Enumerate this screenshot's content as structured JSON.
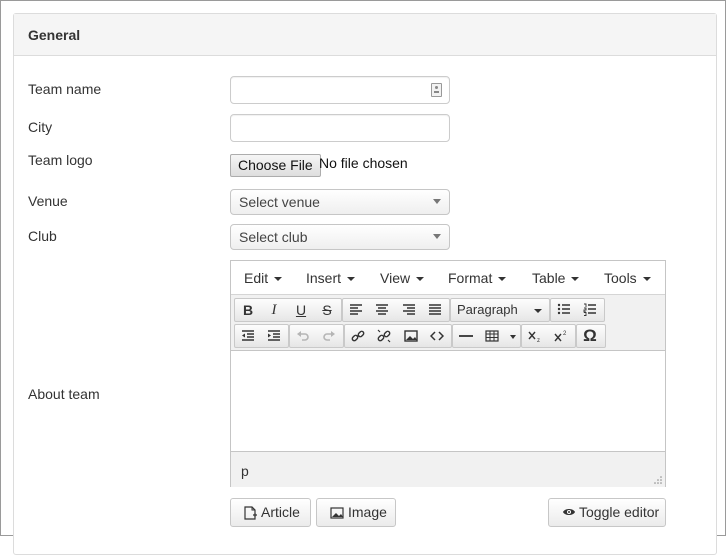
{
  "panel": {
    "title": "General"
  },
  "form": {
    "team_name_label": "Team name",
    "team_name_value": "",
    "city_label": "City",
    "city_value": "",
    "logo_label": "Team logo",
    "logo_button": "Choose File",
    "logo_status": "No file chosen",
    "venue_label": "Venue",
    "venue_value": "Select venue",
    "club_label": "Club",
    "club_value": "Select club",
    "about_label": "About team"
  },
  "editor": {
    "menus": [
      "Edit",
      "Insert",
      "View",
      "Format",
      "Table",
      "Tools"
    ],
    "toolbar": {
      "bold": "B",
      "italic": "I",
      "underline": "U",
      "strike": "S",
      "block_format": "Paragraph",
      "special_char": "Ω",
      "icons": [
        "bold-icon",
        "italic-icon",
        "underline-icon",
        "strikethrough-icon",
        "align-left-icon",
        "align-center-icon",
        "align-right-icon",
        "justify-icon",
        "bullet-list-icon",
        "numbered-list-icon",
        "outdent-icon",
        "indent-icon",
        "undo-icon",
        "redo-icon",
        "link-icon",
        "unlink-icon",
        "image-icon",
        "code-icon",
        "horizontal-rule-icon",
        "table-icon",
        "subscript-icon",
        "superscript-icon",
        "special-character-icon"
      ]
    },
    "content": "",
    "path": "p"
  },
  "actions": {
    "article": "Article",
    "image": "Image",
    "toggle": "Toggle editor"
  }
}
